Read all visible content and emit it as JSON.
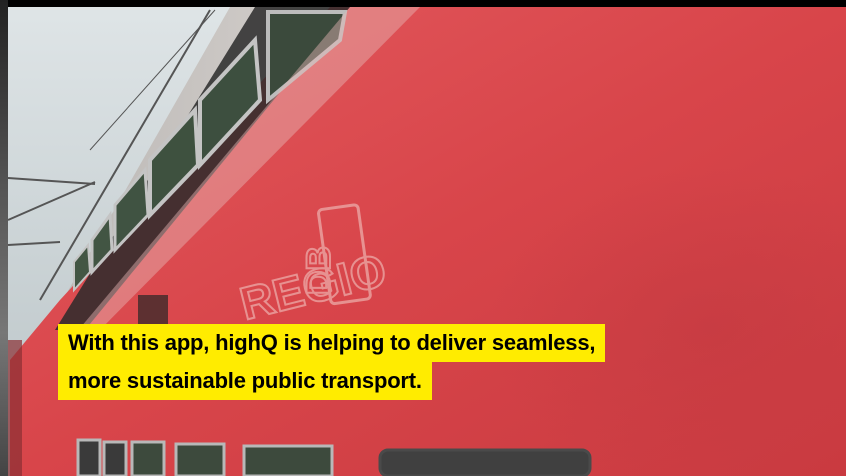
{
  "caption": {
    "line1": "With this app, highQ is helping to deliver seamless,",
    "line2": "more sustainable public transport."
  },
  "train_logo": {
    "regio": "REGIO",
    "db": "DB"
  },
  "colors": {
    "train_red": "#d8454a",
    "caption_yellow": "#ffec00",
    "sky": "#c9d3d6"
  }
}
